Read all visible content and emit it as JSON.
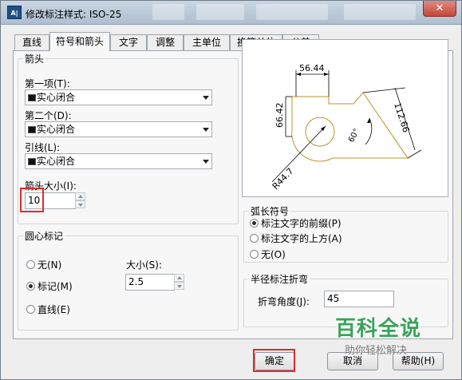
{
  "window": {
    "title": "修改标注样式: ISO-25",
    "close_glyph": "✕",
    "app_icon_text": "A|"
  },
  "tabs": [
    {
      "label": "直线",
      "active": false
    },
    {
      "label": "符号和箭头",
      "active": true
    },
    {
      "label": "文字",
      "active": false
    },
    {
      "label": "调整",
      "active": false
    },
    {
      "label": "主单位",
      "active": false
    },
    {
      "label": "换算单位",
      "active": false
    },
    {
      "label": "公差",
      "active": false
    }
  ],
  "arrowheads": {
    "title": "箭头",
    "first_label": "第一项(T):",
    "first_value": "实心闭合",
    "second_label": "第二个(D):",
    "second_value": "实心闭合",
    "leader_label": "引线(L):",
    "leader_value": "实心闭合",
    "size_label": "箭头大小(I):",
    "size_value": "10"
  },
  "center_marks": {
    "title": "圆心标记",
    "none_label": "无(N)",
    "mark_label": "标记(M)",
    "line_label": "直线(E)",
    "selected": "mark",
    "size_label": "大小(S):",
    "size_value": "2.5"
  },
  "preview": {
    "dim_top": "56.44",
    "dim_left": "66.42",
    "dim_right": "112.66",
    "dim_radius": "R44.7",
    "dim_angle": "60°",
    "line_color": "#b8962e"
  },
  "arc_length": {
    "title": "弧长符号",
    "opt1": "标注文字的前缀(P)",
    "opt2": "标注文字的上方(A)",
    "opt3": "无(O)",
    "selected": "opt1"
  },
  "radius_jog": {
    "title": "半径标注折弯",
    "angle_label": "折弯角度(J):",
    "angle_value": "45"
  },
  "buttons": {
    "ok": "确定",
    "cancel": "取消",
    "help": "帮助(H)"
  },
  "watermark": {
    "title": "百科全说",
    "subtitle": "助你轻松解决"
  },
  "colors": {
    "highlight": "#e02a2a",
    "watermark_green": "#3aa35a"
  }
}
